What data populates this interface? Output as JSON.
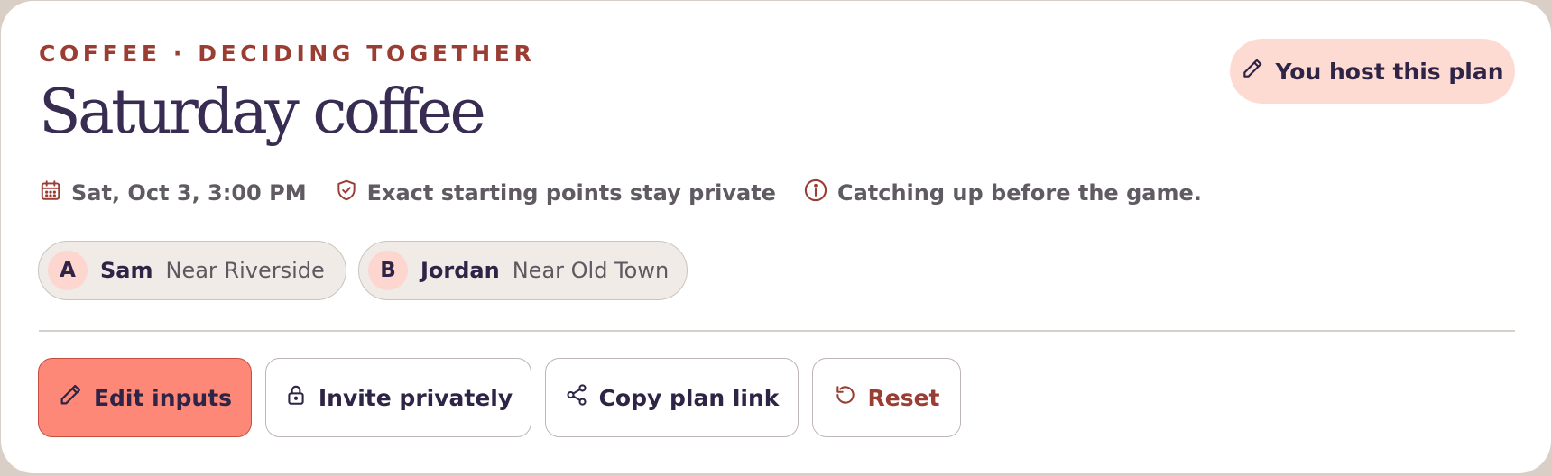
{
  "header": {
    "eyebrow": "COFFEE · DECIDING TOGETHER",
    "title": "Saturday coffee",
    "host_badge": {
      "label": "You host this plan",
      "icon": "pencil-icon"
    }
  },
  "meta": {
    "datetime": {
      "text": "Sat, Oct 3, 3:00 PM",
      "icon": "calendar-icon"
    },
    "privacy": {
      "text": "Exact starting points stay private",
      "icon": "shield-check-icon"
    },
    "note": {
      "text": "Catching up before the game.",
      "icon": "info-icon"
    }
  },
  "participants": [
    {
      "initial": "A",
      "name": "Sam",
      "location": "Near Riverside"
    },
    {
      "initial": "B",
      "name": "Jordan",
      "location": "Near Old Town"
    }
  ],
  "actions": {
    "edit": {
      "label": "Edit inputs",
      "icon": "pencil-icon"
    },
    "invite": {
      "label": "Invite privately",
      "icon": "lock-icon"
    },
    "copy": {
      "label": "Copy plan link",
      "icon": "share-icon"
    },
    "reset": {
      "label": "Reset",
      "icon": "reset-icon"
    }
  },
  "colors": {
    "accent": "#9a3d33",
    "title": "#382c52",
    "primary_button": "#fe8878",
    "host_badge_bg": "#fddbd3",
    "chip_bg": "#f0ebe6"
  }
}
